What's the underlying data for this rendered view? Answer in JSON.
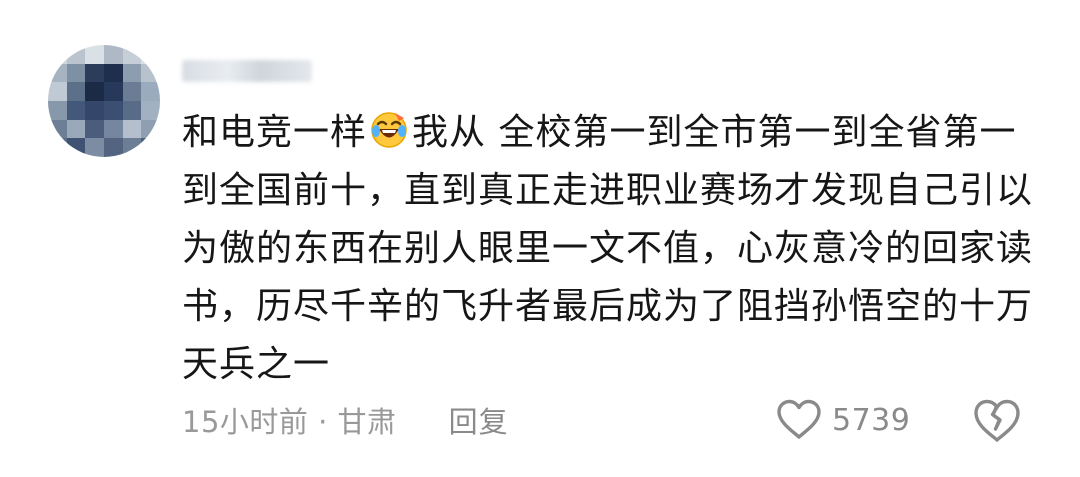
{
  "comment": {
    "text_before_emoji": "和电竞一样",
    "emoji": "rolling-laughing-emoji",
    "text_after_emoji": "我从 全校第一到全市第一到全省第一到全国前十，直到真正走进职业赛场才发现自己引以为傲的东西在别人眼里一文不值，心灰意冷的回家读书，历尽千辛的飞升者最后成为了阻挡孙悟空的十万天兵之一"
  },
  "meta": {
    "time_location": "15小时前 · 甘肃",
    "reply_label": "回复"
  },
  "actions": {
    "like_icon": "heart-outline-icon",
    "like_count": "5739",
    "dislike_icon": "broken-heart-icon"
  },
  "colors": {
    "text": "#161616",
    "meta": "#999999",
    "icon": "#8a8a8a",
    "background": "#ffffff"
  }
}
